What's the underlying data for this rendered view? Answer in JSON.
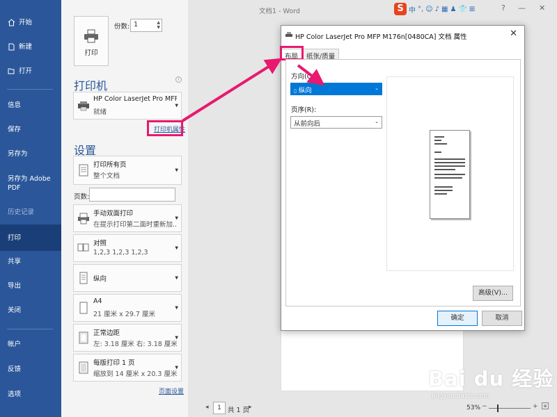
{
  "window": {
    "doc_title": "文档1 - Word",
    "help": "?",
    "minimize": "—",
    "close": "✕"
  },
  "ime": {
    "logo": "S",
    "lang": "中",
    "punct": "°,",
    "items": [
      "☺",
      "♪",
      "▦",
      "♟",
      "👕",
      "⊞"
    ]
  },
  "nav": {
    "items": [
      {
        "label": "开始",
        "icon": "home-icon"
      },
      {
        "label": "新建",
        "icon": "new-doc-icon"
      },
      {
        "label": "打开",
        "icon": "folder-open-icon"
      },
      {
        "label": "信息"
      },
      {
        "label": "保存"
      },
      {
        "label": "另存为"
      },
      {
        "label": "另存为 Adobe PDF"
      },
      {
        "label": "历史记录"
      },
      {
        "label": "打印"
      },
      {
        "label": "共享"
      },
      {
        "label": "导出"
      },
      {
        "label": "关闭"
      },
      {
        "label": "帐户"
      },
      {
        "label": "反馈"
      },
      {
        "label": "选项"
      }
    ]
  },
  "print": {
    "print_button": "打印",
    "copies_label": "份数:",
    "copies_value": "1",
    "printer_section": "打印机",
    "printer_name": "HP Color LaserJet Pro MFP...",
    "printer_status": "就绪",
    "printer_properties_link": "打印机属性",
    "settings_section": "设置",
    "pages_label": "页数:",
    "page_setup_link": "页面设置",
    "options": [
      {
        "l1": "打印所有页",
        "l2": "整个文档"
      },
      {
        "l1": "手动双面打印",
        "l2": "在提示打印第二面时重新加..."
      },
      {
        "l1": "对照",
        "l2": "1,2,3    1,2,3    1,2,3"
      },
      {
        "l1": "纵向",
        "l2": ""
      },
      {
        "l1": "A4",
        "l2": "21 厘米 x 29.7 厘米"
      },
      {
        "l1": "正常边距",
        "l2": "左: 3.18 厘米    右: 3.18 厘米"
      },
      {
        "l1": "每版打印 1 页",
        "l2": "缩放到 14 厘米 x 20.3 厘米"
      }
    ]
  },
  "preview": {
    "page_num": "1",
    "page_total": "共 1 页",
    "zoom": "53%"
  },
  "dialog": {
    "title": "HP Color LaserJet Pro MFP M176n[0480CA] 文档 属性",
    "tabs": [
      "布局",
      "纸张/质量"
    ],
    "orientation_label": "方向(O):",
    "orientation_value": "纵向",
    "order_label": "页序(R):",
    "order_value": "从前向后",
    "advanced_button": "高级(V)...",
    "ok_button": "确定",
    "cancel_button": "取消"
  },
  "watermark": {
    "brand": "Bai du 经验",
    "url": "jingyan.baidu.com"
  },
  "colors": {
    "nav": "#2b579a",
    "highlight": "#e8196f",
    "selection": "#0078d7"
  }
}
